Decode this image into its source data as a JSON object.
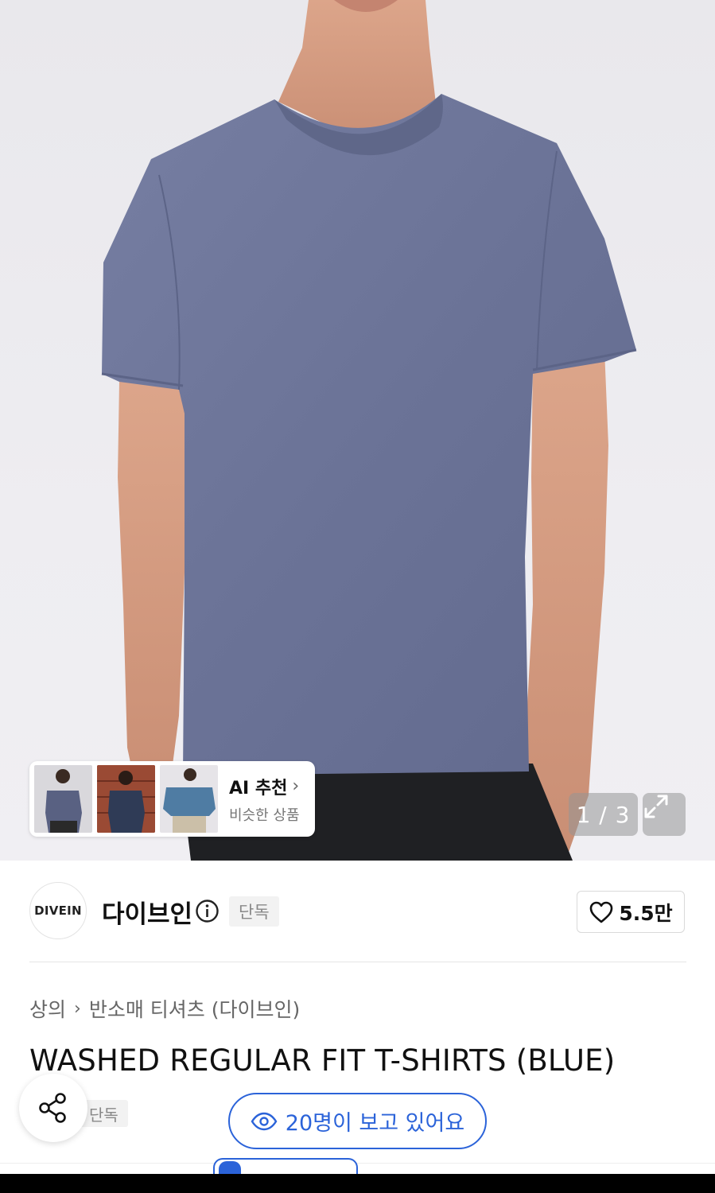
{
  "gallery": {
    "counter": "1 / 3",
    "ai_card": {
      "title": "AI 추천",
      "chevron": "›",
      "subtitle": "비슷한 상품"
    }
  },
  "brand": {
    "logo_text": "DIVEIN",
    "name": "다이브인",
    "badge": "단독"
  },
  "like": {
    "count": "5.5만"
  },
  "breadcrumb": {
    "items": [
      "상의",
      "반소매 티셔츠 (다이브인)"
    ],
    "separator": "›"
  },
  "product": {
    "title": "WASHED REGULAR FIT T-SHIRTS (BLUE)",
    "badge": "단독"
  },
  "viewers": {
    "text": "20명이 보고 있어요"
  },
  "colors": {
    "accent": "#2b63d9",
    "shirt": "#6b7397",
    "background": "#ffffff"
  }
}
